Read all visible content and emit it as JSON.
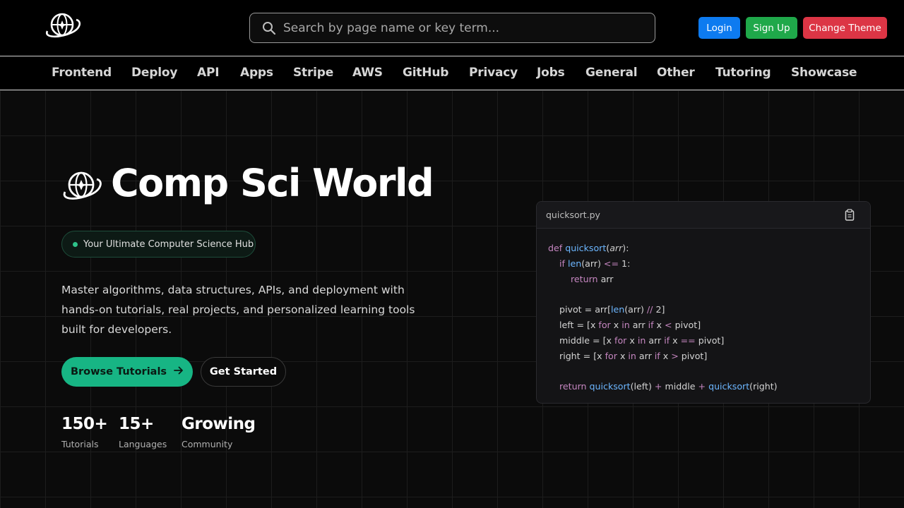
{
  "header": {
    "logo_icon": "globe-sparkle-icon",
    "search_placeholder": "Search by page name or key term...",
    "search_value": "",
    "login_label": "Login",
    "signup_label": "Sign Up",
    "theme_label": "Change Theme",
    "colors": {
      "login": "#0d7bf0",
      "signup": "#1fa84a",
      "theme": "#dc3545"
    }
  },
  "nav": {
    "items": [
      "Frontend",
      "Deploy",
      "API",
      "Apps",
      "Stripe",
      "AWS",
      "GitHub",
      "Privacy",
      "Jobs",
      "General",
      "Other",
      "Tutoring",
      "Showcase"
    ]
  },
  "hero": {
    "title": "Comp Sci World",
    "badge": "Your Ultimate Computer Science Hub",
    "description_lines": [
      "Master algorithms, data structures, APIs, and deployment with",
      "hands-on tutorials, real projects, and personalized learning tools",
      "built for developers."
    ],
    "browse_label": "Browse Tutorials",
    "start_label": "Get Started",
    "accent": "#17b584",
    "stats": [
      {
        "value": "150+",
        "label": "Tutorials"
      },
      {
        "value": "15+",
        "label": "Languages"
      },
      {
        "value": "Growing",
        "label": "Community"
      }
    ]
  },
  "code_card": {
    "filename": "quicksort.py",
    "copy_icon": "clipboard-icon",
    "lines": [
      "def quicksort(arr):",
      "    if len(arr) <= 1:",
      "        return arr",
      "",
      "    pivot = arr[len(arr) // 2]",
      "    left = [x for x in arr if x < pivot]",
      "    middle = [x for x in arr if x == pivot]",
      "    right = [x for x in arr if x > pivot]",
      "",
      "    return quicksort(left) + middle + quicksort(right)"
    ]
  }
}
